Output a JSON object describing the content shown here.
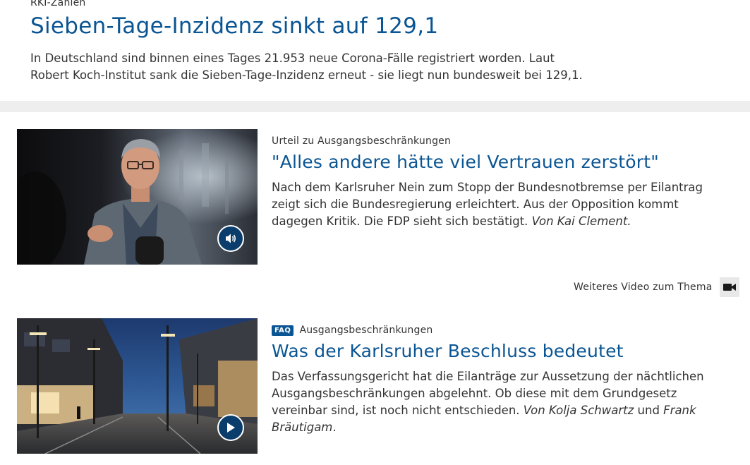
{
  "top_teaser": {
    "kicker": "RKI-Zahlen",
    "title": "Sieben-Tage-Inzidenz sinkt auf 129,1",
    "text": "In Deutschland sind binnen eines Tages 21.953 neue Corona-Fälle registriert worden. Laut Robert Koch-Institut sank die Sieben-Tage-Inzidenz erneut - sie liegt nun bundesweit bei 129,1."
  },
  "teasers": [
    {
      "kicker": "Urteil zu Ausgangsbeschränkungen",
      "title": "\"Alles andere hätte viel Vertrauen zerstört\"",
      "text": "Nach dem Karlsruher Nein zum Stopp der Bundesnotbremse per Eilantrag zeigt sich die Bundesregierung erleichtert. Aus der Opposition kommt dagegen Kritik. Die FDP sieht sich bestätigt.",
      "author_prefix": "Von Kai Clement.",
      "media_icon": "audio-icon",
      "image_description": "man-with-glasses-speaking"
    },
    {
      "badge": "FAQ",
      "kicker": "Ausgangsbeschränkungen",
      "title": "Was der Karlsruher Beschluss bedeutet",
      "text": "Das Verfassungsgericht hat die Eilanträge zur Aussetzung der nächtlichen Ausgangsbeschränkungen abgelehnt. Ob diese mit dem Grundgesetz vereinbar sind, ist noch nicht entschieden.",
      "author_1": "Von Kolja Schwartz",
      "author_joiner": " und ",
      "author_2": "Frank Bräutigam",
      "author_end": ".",
      "media_icon": "play-icon",
      "image_description": "empty-street-at-night"
    }
  ],
  "more_video": {
    "label": "Weiteres Video zum Thema",
    "icon": "video-camera-icon"
  },
  "colors": {
    "title_blue": "#0a5593",
    "media_button": "#0a3d6b",
    "divider": "#eeeeee"
  }
}
